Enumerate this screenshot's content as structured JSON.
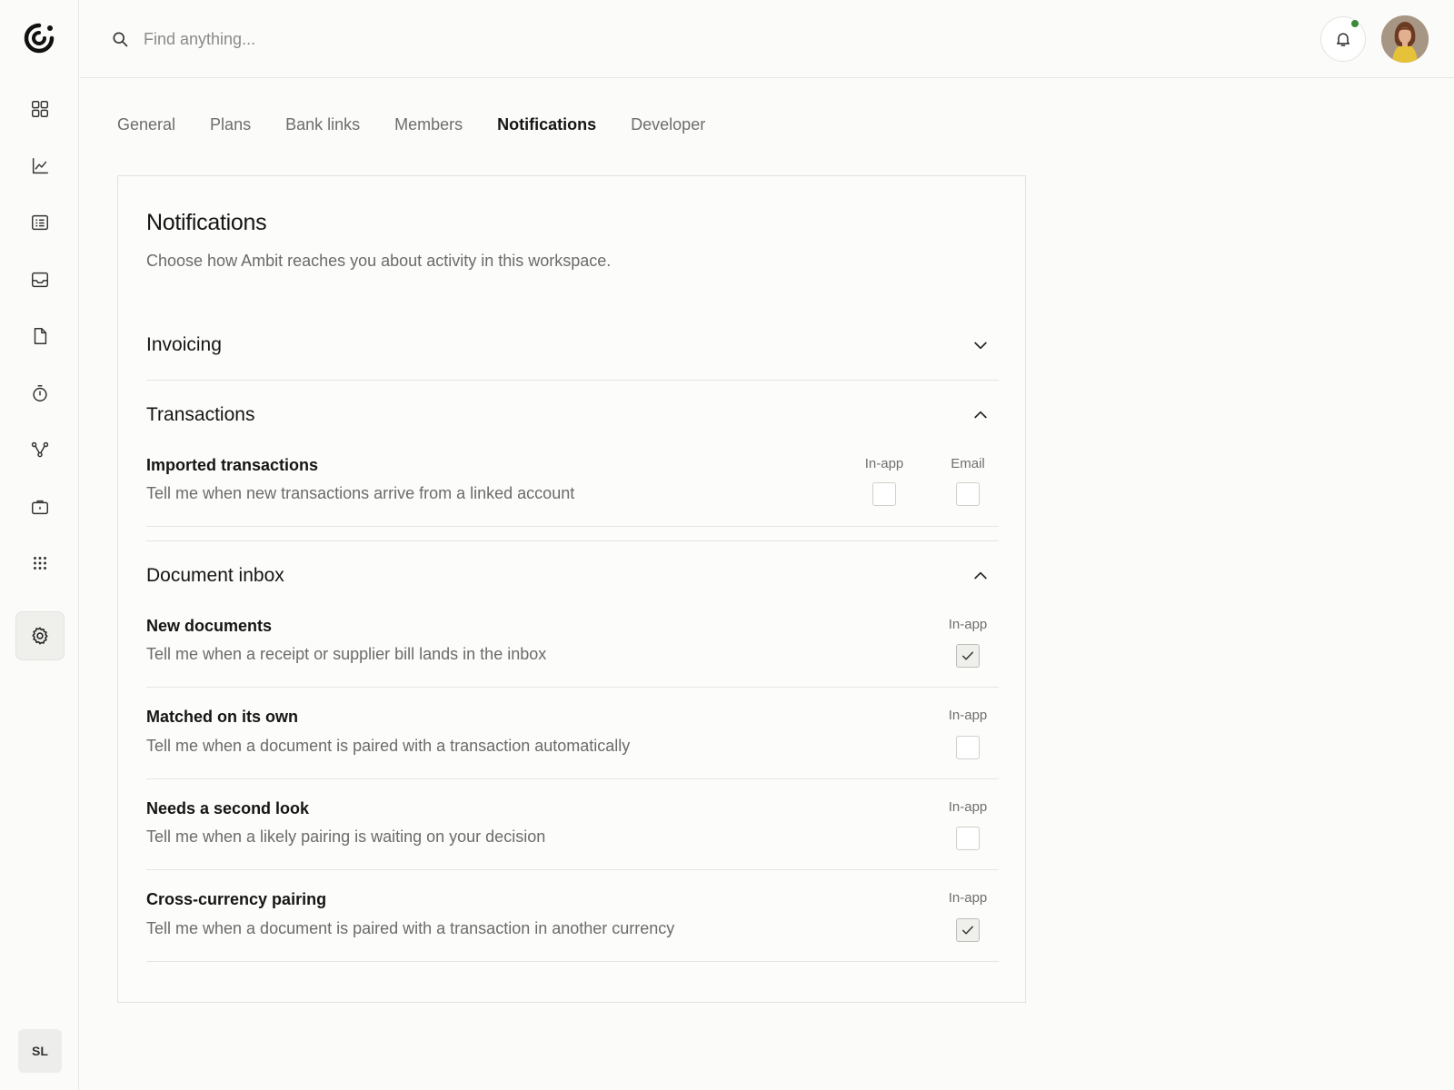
{
  "search": {
    "placeholder": "Find anything..."
  },
  "sidebar": {
    "items": [
      {
        "icon": "grid-icon"
      },
      {
        "icon": "line-chart-icon"
      },
      {
        "icon": "list-icon"
      },
      {
        "icon": "inbox-icon"
      },
      {
        "icon": "document-icon"
      },
      {
        "icon": "timer-icon"
      },
      {
        "icon": "branch-icon"
      },
      {
        "icon": "briefcase-icon"
      },
      {
        "icon": "apps-icon"
      },
      {
        "icon": "gear-icon"
      }
    ],
    "user_initials": "SL"
  },
  "tabs": [
    {
      "label": "General"
    },
    {
      "label": "Plans"
    },
    {
      "label": "Bank links"
    },
    {
      "label": "Members"
    },
    {
      "label": "Notifications",
      "active": true
    },
    {
      "label": "Developer"
    }
  ],
  "card": {
    "title": "Notifications",
    "subtitle": "Choose how Ambit reaches you about activity in this workspace."
  },
  "sections": {
    "invoicing": {
      "title": "Invoicing",
      "expanded": false
    },
    "transactions": {
      "title": "Transactions",
      "expanded": true,
      "rows": [
        {
          "title": "Imported transactions",
          "desc": "Tell me when new transactions arrive from a linked account",
          "in_app_label": "In-app",
          "email_label": "Email",
          "in_app": false,
          "email": false
        }
      ]
    },
    "document_inbox": {
      "title": "Document inbox",
      "expanded": true,
      "rows": [
        {
          "title": "New documents",
          "desc": "Tell me when a receipt or supplier bill lands in the inbox",
          "in_app_label": "In-app",
          "in_app": true
        },
        {
          "title": "Matched on its own",
          "desc": "Tell me when a document is paired with a transaction automatically",
          "in_app_label": "In-app",
          "in_app": false
        },
        {
          "title": "Needs a second look",
          "desc": "Tell me when a likely pairing is waiting on your decision",
          "in_app_label": "In-app",
          "in_app": false
        },
        {
          "title": "Cross-currency pairing",
          "desc": "Tell me when a document is paired with a transaction in another currency",
          "in_app_label": "In-app",
          "in_app": true
        }
      ]
    }
  },
  "colors": {
    "accent_dot": "#3a8a3a",
    "text": "#151515",
    "muted": "#6b6b6b"
  }
}
